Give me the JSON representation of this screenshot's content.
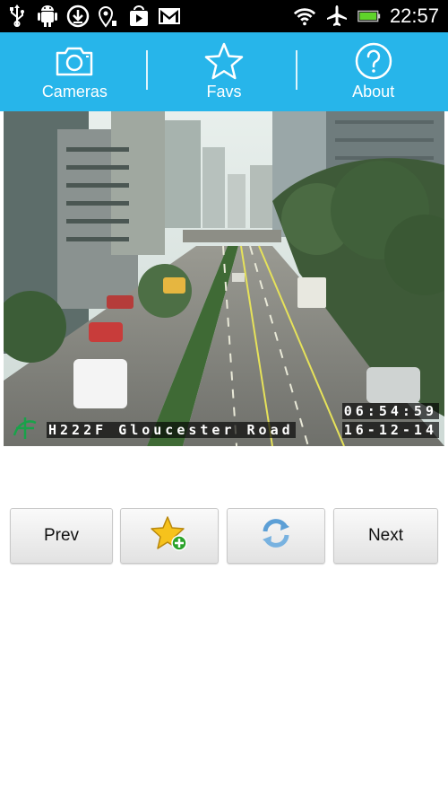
{
  "status_bar": {
    "time": "22:57",
    "left_icons": [
      "usb-icon",
      "android-debug-icon",
      "download-icon",
      "location-icon",
      "play-store-icon",
      "gmail-icon"
    ],
    "right_icons": [
      "wifi-icon",
      "airplane-icon",
      "battery-icon"
    ]
  },
  "nav": {
    "cameras_label": "Cameras",
    "favs_label": "Favs",
    "about_label": "About"
  },
  "camera": {
    "location": "H222F Gloucester Road",
    "time": "06:54:59",
    "date": "16-12-14"
  },
  "buttons": {
    "prev_label": "Prev",
    "next_label": "Next",
    "add_fav_icon": "star-add-icon",
    "refresh_icon": "refresh-icon"
  },
  "colors": {
    "nav_bg": "#27b5ea",
    "status_bg": "#000000"
  }
}
